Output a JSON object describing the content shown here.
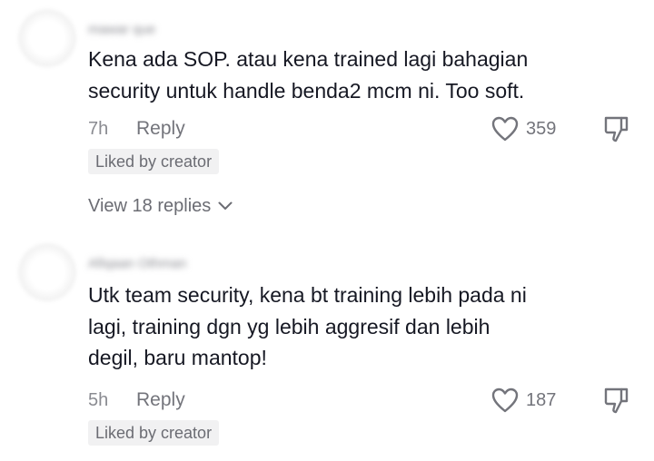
{
  "comments": [
    {
      "username": "mawar que",
      "text": "Kena ada SOP. atau kena trained lagi bahagian\nsecurity untuk handle benda2 mcm ni. Too soft.",
      "time": "7h",
      "reply_label": "Reply",
      "likes": "359",
      "badge": "Liked by creator",
      "view_replies": "View 18 replies"
    },
    {
      "username": "Afiqaan Othman",
      "text": "Utk team security, kena bt training lebih pada ni\nlagi, training dgn yg lebih aggresif dan lebih\ndegil, baru mantop!",
      "time": "5h",
      "reply_label": "Reply",
      "likes": "187",
      "badge": "Liked by creator"
    }
  ],
  "icons": {
    "like": "heart-outline-icon",
    "dislike": "thumbs-down-icon",
    "chevron": "chevron-down-icon"
  },
  "colors": {
    "text": "#161823",
    "secondary": "#73747b",
    "badge_bg": "#f1f1f2"
  }
}
